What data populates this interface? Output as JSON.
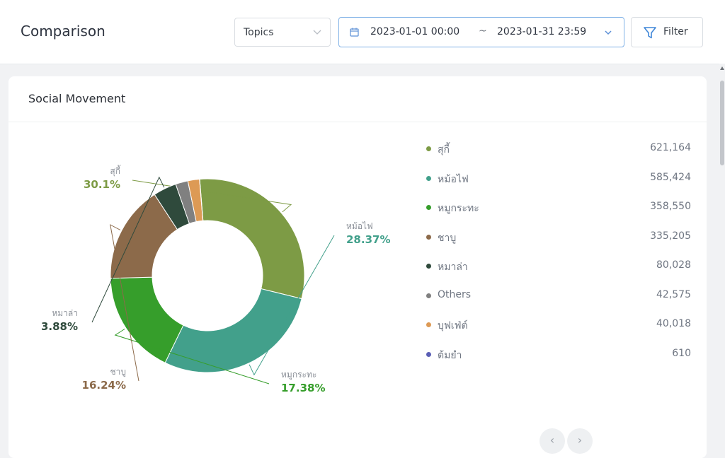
{
  "header": {
    "title": "Comparison",
    "topics_select": {
      "value": "Topics"
    },
    "date_range": {
      "start": "2023-01-01 00:00",
      "separator": "~",
      "end": "2023-01-31 23:59"
    },
    "filter_label": "Filter"
  },
  "card": {
    "title": "Social Movement"
  },
  "colors": {
    "accent_border": "#7fb1e6",
    "label_text": "#6f7682"
  },
  "chart_data": {
    "type": "pie",
    "donut": true,
    "title": "",
    "slices": [
      {
        "label": "สุกี้",
        "value": 621164,
        "color": "#7d9b45",
        "pct_label": "30.1%"
      },
      {
        "label": "หม้อไฟ",
        "value": 585424,
        "color": "#42a08b",
        "pct_label": "28.37%"
      },
      {
        "label": "หมูกระทะ",
        "value": 358550,
        "color": "#369e2b",
        "pct_label": "17.38%"
      },
      {
        "label": "ชาบู",
        "value": 335205,
        "color": "#8c6a4a",
        "pct_label": "16.24%"
      },
      {
        "label": "หมาล่า",
        "value": 80028,
        "color": "#2f4a3c",
        "pct_label": "3.88%"
      },
      {
        "label": "Others",
        "value": 42575,
        "color": "#808080",
        "pct_label": ""
      },
      {
        "label": "บุฟเฟ่ต์",
        "value": 40018,
        "color": "#dd9a55",
        "pct_label": ""
      },
      {
        "label": "ต้มยำ",
        "value": 610,
        "color": "#5b5fb5",
        "pct_label": ""
      }
    ],
    "legend": [
      {
        "label": "สุกี้",
        "value": "621,164",
        "color": "#7d9b45"
      },
      {
        "label": "หม้อไฟ",
        "value": "585,424",
        "color": "#42a08b"
      },
      {
        "label": "หมูกระทะ",
        "value": "358,550",
        "color": "#369e2b"
      },
      {
        "label": "ชาบู",
        "value": "335,205",
        "color": "#8c6a4a"
      },
      {
        "label": "หมาล่า",
        "value": "80,028",
        "color": "#2f4a3c"
      },
      {
        "label": "Others",
        "value": "42,575",
        "color": "#808080"
      },
      {
        "label": "บุฟเฟ่ต์",
        "value": "40,018",
        "color": "#dd9a55"
      },
      {
        "label": "ต้มยำ",
        "value": "610",
        "color": "#5b5fb5"
      }
    ],
    "legend_placement": "right"
  },
  "pager": {
    "prev_icon": "chevron-left-icon",
    "next_icon": "chevron-right-icon"
  }
}
